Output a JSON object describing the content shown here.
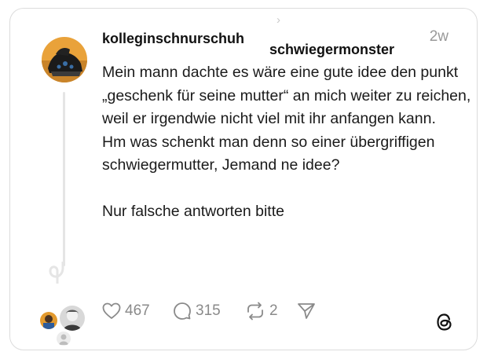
{
  "post": {
    "author": "kolleginschnurschuh",
    "reply_to": "schwiegermonster",
    "timestamp": "2w",
    "text": "Mein mann dachte es wäre eine gute idee den punkt „geschenk für seine mutter“ an mich weiter zu reichen, weil er irgendwie nicht viel mit ihr anfangen kann.\nHm was schenkt man denn so einer übergriffigen schwiegermutter, Jemand ne idee?\n\nNur falsche antworten bitte"
  },
  "actions": {
    "likes": "467",
    "replies": "315",
    "reposts": "2"
  },
  "icons": {
    "like": "heart-icon",
    "reply": "speech-bubble-icon",
    "repost": "repost-arrows-icon",
    "share": "send-arrow-icon",
    "logo": "threads-logo-icon"
  },
  "colors": {
    "text": "#1a1a1a",
    "muted": "#8a8a8a",
    "border": "#dcdcdc",
    "thread_line": "#e5e5e5"
  }
}
